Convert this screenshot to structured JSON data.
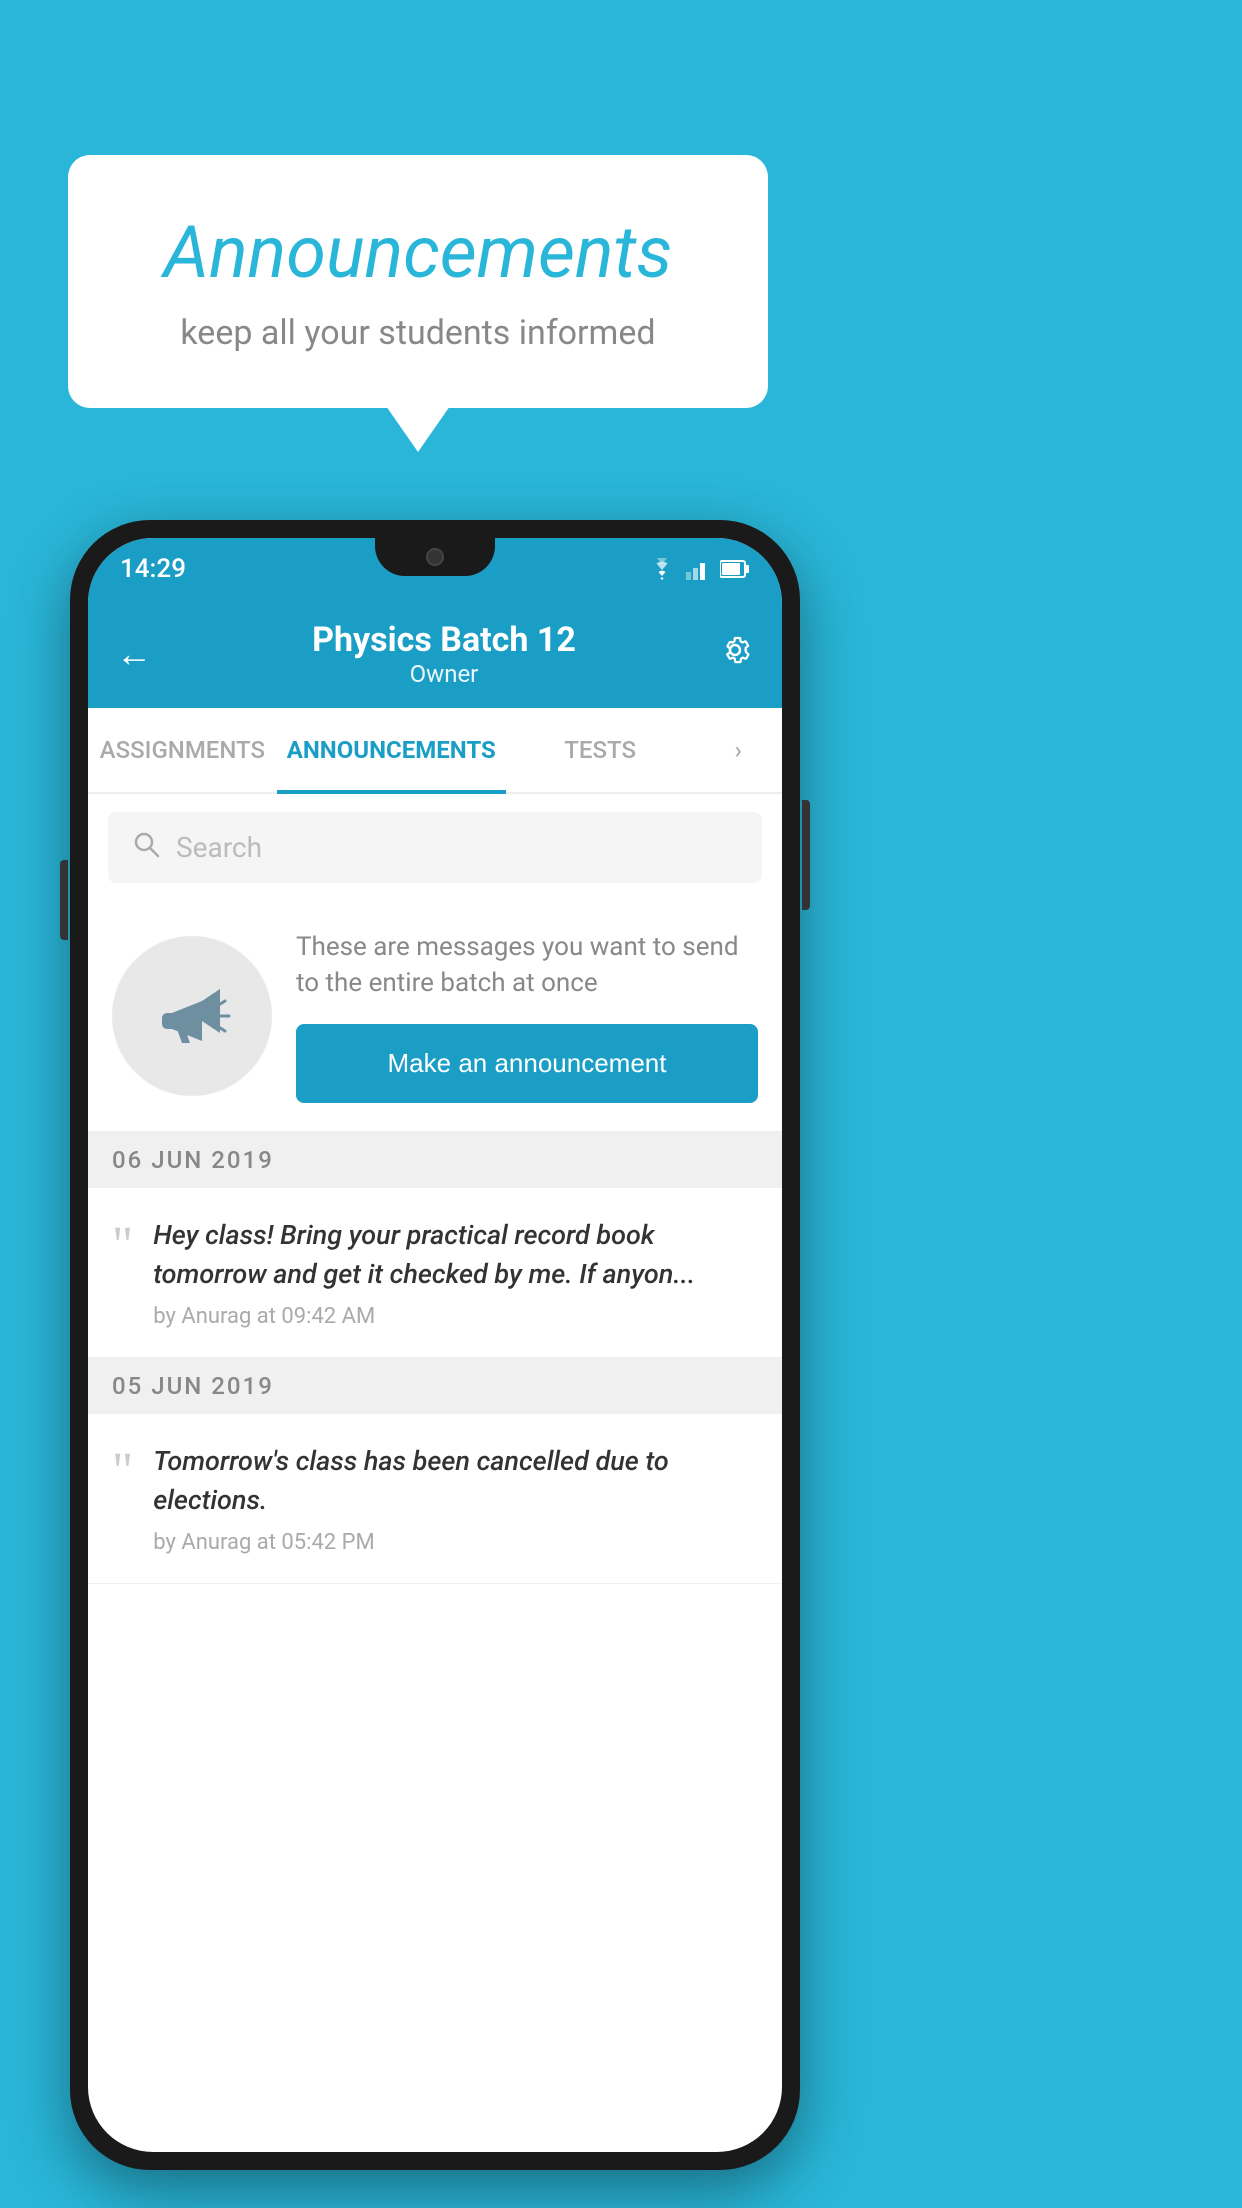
{
  "background_color": "#29b6d8",
  "speech_bubble": {
    "title": "Announcements",
    "subtitle": "keep all your students informed"
  },
  "phone": {
    "status_bar": {
      "time": "14:29"
    },
    "app_bar": {
      "title": "Physics Batch 12",
      "subtitle": "Owner",
      "back_label": "←",
      "settings_label": "⚙"
    },
    "tabs": [
      {
        "label": "ASSIGNMENTS",
        "active": false
      },
      {
        "label": "ANNOUNCEMENTS",
        "active": true
      },
      {
        "label": "TESTS",
        "active": false
      },
      {
        "label": "...",
        "active": false
      }
    ],
    "search": {
      "placeholder": "Search"
    },
    "promo": {
      "description": "These are messages you want to\nsend to the entire batch at once",
      "button_label": "Make an announcement"
    },
    "announcements": [
      {
        "date": "06  JUN  2019",
        "text": "Hey class! Bring your practical record book tomorrow and get it checked by me. If anyon...",
        "meta": "by Anurag at 09:42 AM"
      },
      {
        "date": "05  JUN  2019",
        "text": "Tomorrow's class has been cancelled due to elections.",
        "meta": "by Anurag at 05:42 PM"
      }
    ]
  }
}
